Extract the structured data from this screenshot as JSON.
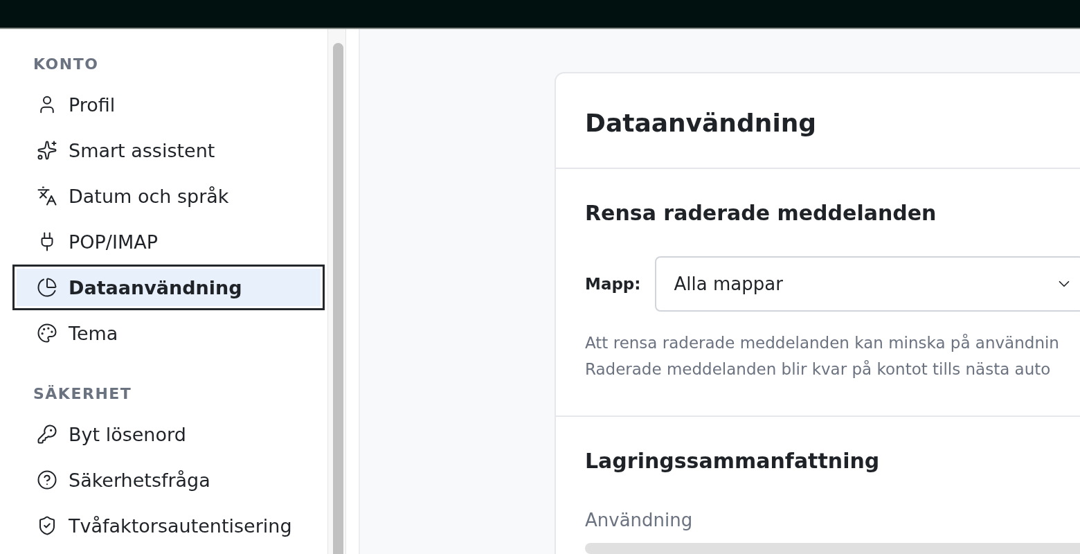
{
  "sidebar": {
    "sections": [
      {
        "title": "KONTO",
        "items": [
          {
            "label": "Profil",
            "selected": false
          },
          {
            "label": "Smart assistent",
            "selected": false
          },
          {
            "label": "Datum och språk",
            "selected": false
          },
          {
            "label": "POP/IMAP",
            "selected": false
          },
          {
            "label": "Dataanvändning",
            "selected": true
          },
          {
            "label": "Tema",
            "selected": false
          }
        ]
      },
      {
        "title": "SÄKERHET",
        "items": [
          {
            "label": "Byt lösenord",
            "selected": false
          },
          {
            "label": "Säkerhetsfråga",
            "selected": false
          },
          {
            "label": "Tvåfaktorsautentisering",
            "selected": false
          }
        ]
      }
    ]
  },
  "main": {
    "title": "Dataanvändning",
    "purge": {
      "heading": "Rensa raderade meddelanden",
      "folder_label": "Mapp:",
      "folder_value": "Alla mappar",
      "help": [
        "Att rensa raderade meddelanden kan minska på användnin",
        "Raderade meddelanden blir kvar på kontot tills nästa auto"
      ]
    },
    "storage": {
      "heading": "Lagringssammanfattning",
      "usage_label": "Användning"
    }
  }
}
